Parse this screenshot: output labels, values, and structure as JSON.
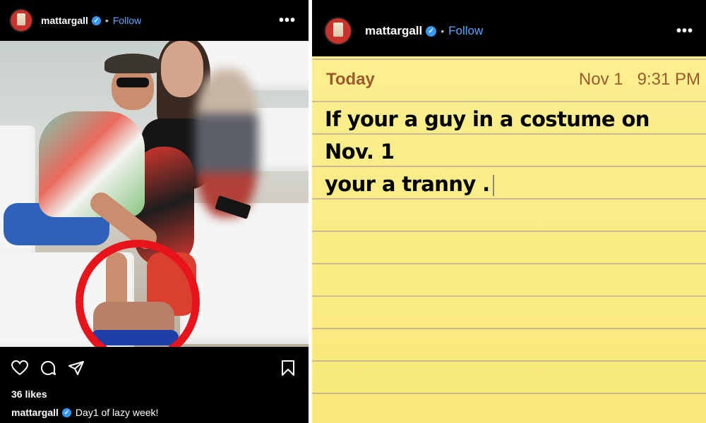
{
  "left_post": {
    "header": {
      "username": "mattargall",
      "verified_mark": "✓",
      "dot": "•",
      "follow": "Follow",
      "more": "•••"
    },
    "likes": "36 likes",
    "caption": {
      "username": "mattargall",
      "verified_mark": "✓",
      "text": "Day1 of lazy week!"
    },
    "icons": [
      "heart-icon",
      "comment-icon",
      "share-icon",
      "bookmark-icon"
    ]
  },
  "right_post": {
    "header": {
      "username": "mattargall",
      "verified_mark": "✓",
      "dot": "•",
      "follow": "Follow",
      "more": "•••"
    },
    "note": {
      "heading": "Today",
      "date": "Nov 1",
      "time": "9:31 PM",
      "line1": "If your a guy in a costume on Nov. 1",
      "line2": "your a tranny ."
    }
  },
  "colors": {
    "accent_follow": "#5aa8ff",
    "verified": "#3897f0",
    "highlight_circle": "#e8141b",
    "note_paper": "#f9e97a",
    "note_header": "#9a5a2d"
  }
}
